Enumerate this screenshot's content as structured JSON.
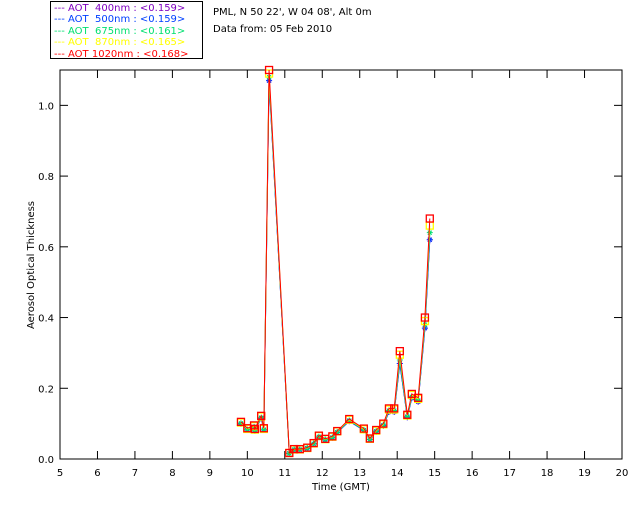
{
  "header": {
    "location": "PML, N 50 22', W 04 08', Alt 0m",
    "date": "Data from: 05 Feb 2010"
  },
  "chart_data": {
    "type": "line",
    "xlabel": "Time (GMT)",
    "ylabel": "Aerosol Optical Thickness",
    "xlim": [
      5,
      20
    ],
    "ylim": [
      0,
      1.1
    ],
    "xticks": [
      "5",
      "6",
      "7",
      "8",
      "9",
      "10",
      "11",
      "12",
      "13",
      "14",
      "15",
      "16",
      "17",
      "18",
      "19",
      "20"
    ],
    "yticks": [
      "0.0",
      "0.2",
      "0.4",
      "0.6",
      "0.8",
      "1.0"
    ],
    "grid": false,
    "legend_position": "top-left",
    "x": [
      9.83,
      10.0,
      10.18,
      10.2,
      10.37,
      10.44,
      10.58,
      11.12,
      11.25,
      11.4,
      11.6,
      11.77,
      11.91,
      12.08,
      12.27,
      12.4,
      12.72,
      13.11,
      13.27,
      13.44,
      13.63,
      13.78,
      13.92,
      14.07,
      14.27,
      14.39,
      14.56,
      14.74,
      14.87
    ],
    "series": [
      {
        "name": "AOT  400nm : <0.159>",
        "color": "#7f00c0",
        "marker": "asterisk",
        "values": [
          0.099,
          0.082,
          0.09,
          0.08,
          0.115,
          0.082,
          1.07,
          0.016,
          0.026,
          0.026,
          0.03,
          0.043,
          0.062,
          0.054,
          0.06,
          0.075,
          0.107,
          0.081,
          0.055,
          0.077,
          0.094,
          0.133,
          0.133,
          0.27,
          0.118,
          0.172,
          0.162,
          0.37,
          0.62
        ]
      },
      {
        "name": "AOT  500nm : <0.159>",
        "color": "#0040ff",
        "marker": "asterisk",
        "values": [
          0.099,
          0.082,
          0.09,
          0.08,
          0.115,
          0.082,
          1.07,
          0.016,
          0.026,
          0.026,
          0.03,
          0.043,
          0.062,
          0.054,
          0.06,
          0.075,
          0.107,
          0.081,
          0.055,
          0.077,
          0.094,
          0.134,
          0.134,
          0.27,
          0.118,
          0.173,
          0.163,
          0.37,
          0.62
        ]
      },
      {
        "name": "AOT  675nm : <0.161>",
        "color": "#00e070",
        "marker": "asterisk",
        "values": [
          0.101,
          0.083,
          0.091,
          0.081,
          0.117,
          0.083,
          1.08,
          0.016,
          0.027,
          0.027,
          0.031,
          0.043,
          0.063,
          0.055,
          0.061,
          0.076,
          0.109,
          0.082,
          0.056,
          0.079,
          0.096,
          0.137,
          0.137,
          0.28,
          0.12,
          0.176,
          0.166,
          0.38,
          0.64
        ]
      },
      {
        "name": "AOT  870nm : <0.165>",
        "color": "#ffff00",
        "marker": "square",
        "values": [
          0.103,
          0.085,
          0.093,
          0.083,
          0.12,
          0.085,
          1.09,
          0.017,
          0.027,
          0.027,
          0.031,
          0.044,
          0.065,
          0.056,
          0.063,
          0.078,
          0.111,
          0.084,
          0.057,
          0.08,
          0.098,
          0.14,
          0.14,
          0.295,
          0.123,
          0.181,
          0.17,
          0.39,
          0.66
        ]
      },
      {
        "name": "AOT 1020nm : <0.168>",
        "color": "#ff0000",
        "marker": "square",
        "values": [
          0.105,
          0.087,
          0.095,
          0.085,
          0.122,
          0.087,
          1.1,
          0.017,
          0.028,
          0.028,
          0.032,
          0.045,
          0.066,
          0.057,
          0.064,
          0.079,
          0.113,
          0.086,
          0.058,
          0.082,
          0.1,
          0.143,
          0.143,
          0.305,
          0.125,
          0.184,
          0.173,
          0.4,
          0.68
        ]
      }
    ]
  }
}
